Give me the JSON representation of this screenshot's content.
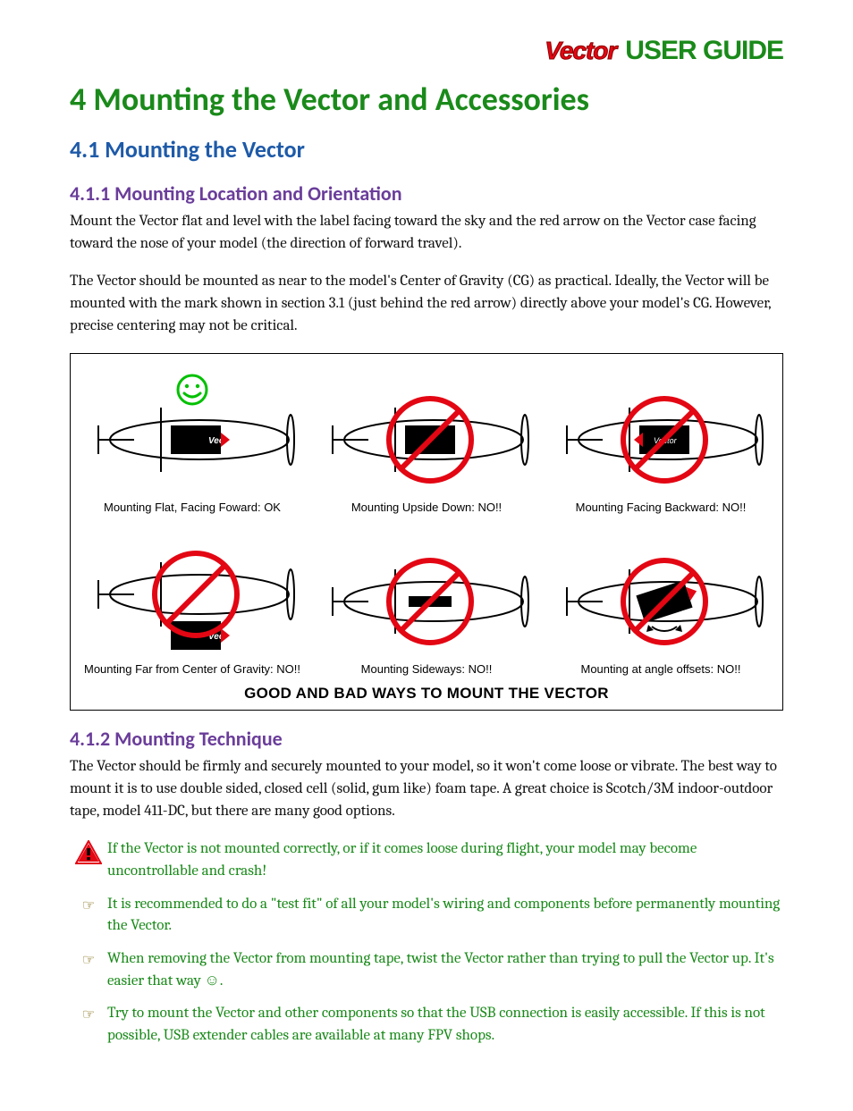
{
  "brand": {
    "logo_text": "Vector",
    "header_label": "USER GUIDE"
  },
  "headings": {
    "h1": "4  Mounting the Vector and Accessories",
    "h2_1": "4.1  Mounting the Vector",
    "h3_1": "4.1.1 Mounting Location and Orientation",
    "h3_2": "4.1.2  Mounting Technique"
  },
  "paragraphs": {
    "p1": "Mount the Vector flat and level with the label facing toward the sky and the red arrow on the Vector case facing toward the nose of your model (the direction of forward travel).",
    "p2": "The Vector should be mounted as near to the model's Center of Gravity (CG) as practical.   Ideally, the Vector will be mounted with the mark shown in section 3.1 (just behind the red arrow) directly above your model's CG.   However, precise centering may not be critical.",
    "p3": "The Vector should be firmly and securely mounted to your model, so it won't come loose or vibrate.   The best way to mount it is to use double sided, closed cell (solid, gum like) foam tape.  A great choice is Scotch/3M indoor-outdoor tape, model 411-DC, but there are many good options."
  },
  "figure": {
    "cells": [
      {
        "caption": "Mounting Flat, Facing Foward:  OK",
        "status": "ok"
      },
      {
        "caption": "Mounting Upside Down: NO!!",
        "status": "no"
      },
      {
        "caption": "Mounting Facing Backward:  NO!!",
        "status": "no"
      },
      {
        "caption": "Mounting Far from Center of Gravity:  NO!!",
        "status": "no"
      },
      {
        "caption": "Mounting Sideways: NO!!",
        "status": "no"
      },
      {
        "caption": "Mounting at angle offsets: NO!!",
        "status": "no"
      }
    ],
    "title": "GOOD AND BAD WAYS TO MOUNT THE VECTOR"
  },
  "notes": {
    "warn": "If the Vector is not mounted correctly, or if it comes loose during flight, your model may become uncontrollable and crash!",
    "tip1": "It is recommended to do a \"test fit\" of all your model's wiring and components before permanently mounting the Vector.",
    "tip2_a": "When removing the Vector from mounting tape, twist the Vector rather than trying to pull the Vector up.  It's easier that way ",
    "tip2_b": "☺.",
    "tip3_a": "Try to mount the Vector and other components so that the USB connection is easily accessible.    ",
    "tip3_b": "If this is not possible, USB extender cables are available at many FPV shops."
  }
}
